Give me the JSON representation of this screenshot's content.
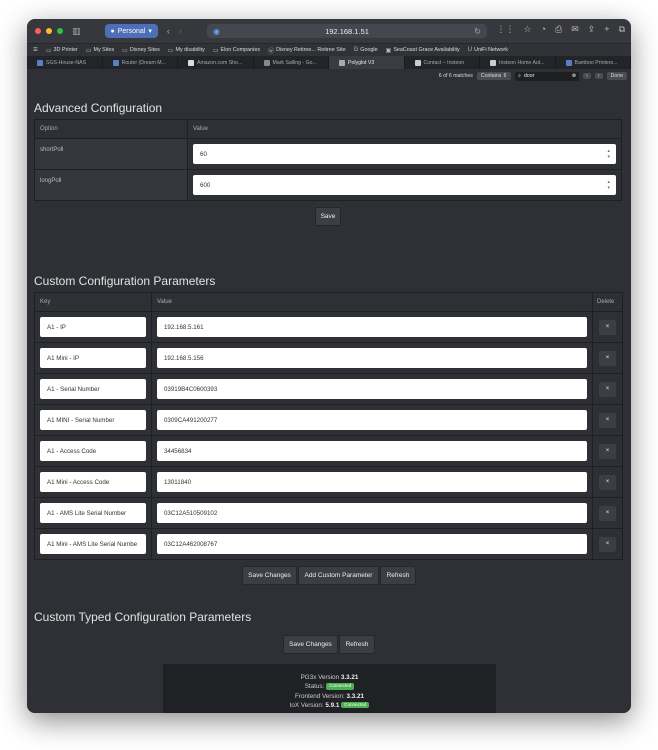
{
  "browser": {
    "profile_label": "Personal",
    "url": "192.168.1.51",
    "favorites": [
      {
        "label": "3D Printer",
        "icon": "folder-icon"
      },
      {
        "label": "My Sites",
        "icon": "folder-icon"
      },
      {
        "label": "Disney Sites",
        "icon": "folder-icon"
      },
      {
        "label": "My disability",
        "icon": "folder-icon"
      },
      {
        "label": "Elon Companies",
        "icon": "folder-icon"
      },
      {
        "label": "Disney Retiree... Retiree Site",
        "icon": "wordpress-icon"
      },
      {
        "label": "Google",
        "icon": "google-icon"
      },
      {
        "label": "SeaCoast Grace Availability",
        "icon": "site-icon"
      },
      {
        "label": "UniFi Network",
        "icon": "unifi-icon"
      }
    ],
    "tabs": [
      {
        "label": "SGS-House-NAS",
        "active": false
      },
      {
        "label": "Router (Dream M...",
        "active": false
      },
      {
        "label": "Amazon.com Sho...",
        "active": false
      },
      {
        "label": "Mark Salling - Go...",
        "active": false
      },
      {
        "label": "Polyglot V3",
        "active": true
      },
      {
        "label": "Contact – Insteon",
        "active": false
      },
      {
        "label": "Insteon Home Aut...",
        "active": false
      },
      {
        "label": "Bamboo Printers...",
        "active": false
      }
    ],
    "find": {
      "matches": "6 of 6 matches",
      "mode": "Contains",
      "query": "door",
      "done_label": "Done"
    }
  },
  "advanced": {
    "title": "Advanced Configuration",
    "col_option": "Option",
    "col_value": "Value",
    "rows": [
      {
        "option": "shortPoll",
        "value": "60"
      },
      {
        "option": "longPoll",
        "value": "600"
      }
    ],
    "save_label": "Save"
  },
  "custom": {
    "title": "Custom Configuration Parameters",
    "col_key": "Key",
    "col_value": "Value",
    "col_delete": "Delete",
    "delete_label": "×",
    "rows": [
      {
        "key": "A1 - IP",
        "value": "192.168.5.161"
      },
      {
        "key": "A1 Mini - IP",
        "value": "192.168.5.156"
      },
      {
        "key": "A1 - Serial Number",
        "value": "03919B4C0600393"
      },
      {
        "key": "A1 MINI - Serial Number",
        "value": "0309CA491200277"
      },
      {
        "key": "A1 - Access Code",
        "value": "34456834"
      },
      {
        "key": "A1 Mini - Access Code",
        "value": "13011840"
      },
      {
        "key": "A1 - AMS Lite Serial Number",
        "value": "03C12A510509102"
      },
      {
        "key": "A1 Mini - AMS Lite Serial Numbe",
        "value": "03C12A462008767"
      }
    ],
    "save_changes_label": "Save Changes",
    "add_label": "Add Custom Parameter",
    "refresh_label": "Refresh"
  },
  "typed": {
    "title": "Custom Typed Configuration Parameters",
    "save_changes_label": "Save Changes",
    "refresh_label": "Refresh"
  },
  "footer": {
    "pg3x_label": "PG3x Version",
    "pg3x_version": "3.3.21",
    "status_label": "Status:",
    "status_value": "Connected",
    "frontend_label": "Frontend Version:",
    "frontend_version": "3.3.21",
    "iox_label": "IoX Version:",
    "iox_version": "5.9.1",
    "iox_status": "Connected"
  },
  "colors": {
    "accent": "#4c6fb8",
    "connected": "#4caf50"
  }
}
